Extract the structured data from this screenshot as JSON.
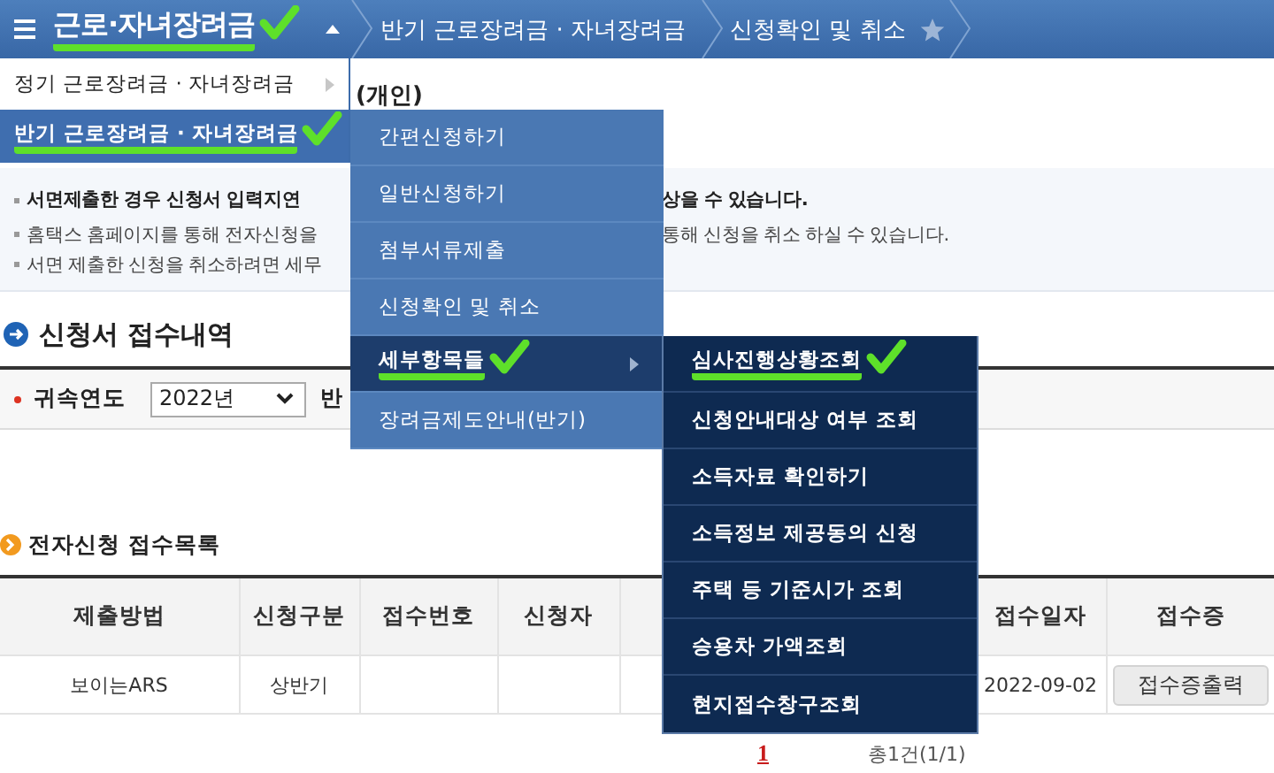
{
  "breadcrumb": {
    "title": "근로·자녀장려금",
    "title_marked": true,
    "crumbs": [
      {
        "label": "반기 근로장려금 · 자녀장려금"
      },
      {
        "label": "신청확인 및 취소",
        "starred": false
      }
    ]
  },
  "menu_level_1": [
    {
      "label": "정기 근로장려금 · 자녀장려금",
      "selected": false,
      "marked": false,
      "submenu": true
    },
    {
      "label": "반기 근로장려금 · 자녀장려금",
      "selected": true,
      "marked": true,
      "submenu": true
    }
  ],
  "menu_level_2": [
    {
      "label": "간편신청하기",
      "selected": false,
      "marked": false,
      "submenu": false
    },
    {
      "label": "일반신청하기",
      "selected": false,
      "marked": false,
      "submenu": false
    },
    {
      "label": "첨부서류제출",
      "selected": false,
      "marked": false,
      "submenu": false
    },
    {
      "label": "신청확인 및 취소",
      "selected": false,
      "marked": false,
      "submenu": false
    },
    {
      "label": "세부항목들",
      "selected": true,
      "marked": true,
      "submenu": true
    },
    {
      "label": "장려금제도안내(반기)",
      "selected": false,
      "marked": false,
      "submenu": false
    }
  ],
  "menu_level_3": [
    {
      "label": "심사진행상황조회",
      "selected": false,
      "marked": true,
      "submenu": false
    },
    {
      "label": "신청안내대상 여부 조회",
      "selected": false,
      "marked": false,
      "submenu": false
    },
    {
      "label": "소득자료 확인하기",
      "selected": false,
      "marked": false,
      "submenu": false
    },
    {
      "label": "소득정보 제공동의 신청",
      "selected": false,
      "marked": false,
      "submenu": false
    },
    {
      "label": "주택 등 기준시가 조회",
      "selected": false,
      "marked": false,
      "submenu": false
    },
    {
      "label": "승용차 가액조회",
      "selected": false,
      "marked": false,
      "submenu": false
    },
    {
      "label": "현지접수창구조회",
      "selected": false,
      "marked": false,
      "submenu": false
    }
  ],
  "page_title": "(개인)",
  "notices": [
    {
      "left": "서면제출한 경우 신청서 입력지연",
      "right": "상을 수 있습니다.",
      "important": true
    },
    {
      "left": "홈택스 홈페이지를 통해 전자신청을",
      "right": "통해 신청을 취소 하실 수 있습니다.",
      "important": false
    },
    {
      "left": "서면 제출한 신청을 취소하려면 세무",
      "important": false
    }
  ],
  "section_1": {
    "title": "신청서 접수내역"
  },
  "filter": {
    "label": "귀속연도",
    "required": true,
    "year": "2022년",
    "label_2": "반"
  },
  "section_2": {
    "title": "전자신청 접수목록"
  },
  "table": {
    "columns": [
      {
        "label": "제출방법"
      },
      {
        "label": "신청구분"
      },
      {
        "label": "접수번호"
      },
      {
        "label": "신청자"
      },
      {
        "label": "접수일자"
      },
      {
        "label": "접수증"
      }
    ],
    "rows": [
      {
        "method": "보이는ARS",
        "type": "상반기",
        "date": "2022-09-02",
        "receipt_button": "접수증출력"
      }
    ]
  },
  "pagination": {
    "pages": [
      {
        "label": "1",
        "selected": true
      }
    ],
    "total": "총1건(1/1)"
  }
}
